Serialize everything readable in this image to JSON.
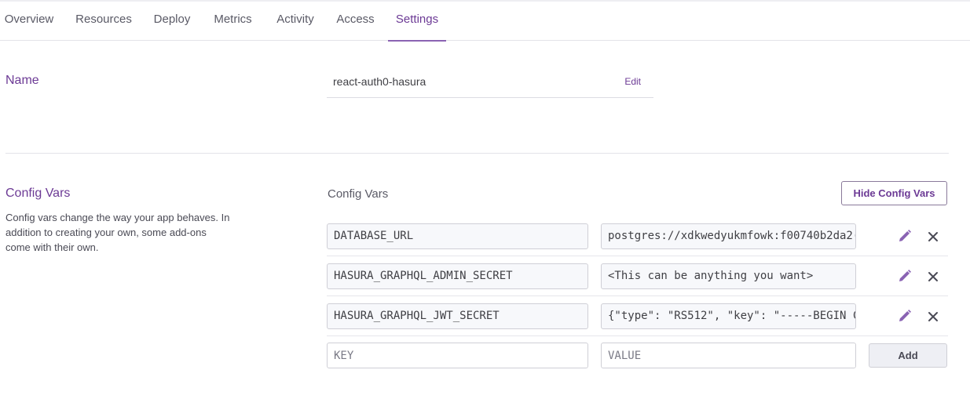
{
  "tabs": [
    {
      "label": "Overview"
    },
    {
      "label": "Resources"
    },
    {
      "label": "Deploy"
    },
    {
      "label": "Metrics"
    },
    {
      "label": "Activity"
    },
    {
      "label": "Access"
    },
    {
      "label": "Settings"
    }
  ],
  "active_tab": "Settings",
  "name_section": {
    "heading": "Name",
    "value": "react-auth0-hasura",
    "edit_label": "Edit"
  },
  "config_vars": {
    "heading": "Config Vars",
    "description": "Config vars change the way your app behaves. In addition to creating your own, some add-ons come with their own.",
    "subtitle": "Config Vars",
    "hide_button_label": "Hide Config Vars",
    "vars": [
      {
        "key": "DATABASE_URL",
        "value": "postgres://xdkwedyukmfowk:f00740b2da2("
      },
      {
        "key": "HASURA_GRAPHQL_ADMIN_SECRET",
        "value": "<This can be anything you want>"
      },
      {
        "key": "HASURA_GRAPHQL_JWT_SECRET",
        "value": "{\"type\": \"RS512\", \"key\": \"-----BEGIN C"
      }
    ],
    "new_var": {
      "key_placeholder": "KEY",
      "value_placeholder": "VALUE",
      "add_label": "Add"
    }
  },
  "icons": {
    "edit": "pencil-icon",
    "delete": "close-icon"
  },
  "colors": {
    "accent": "#6c3a95",
    "pencil": "#8a63b3"
  }
}
